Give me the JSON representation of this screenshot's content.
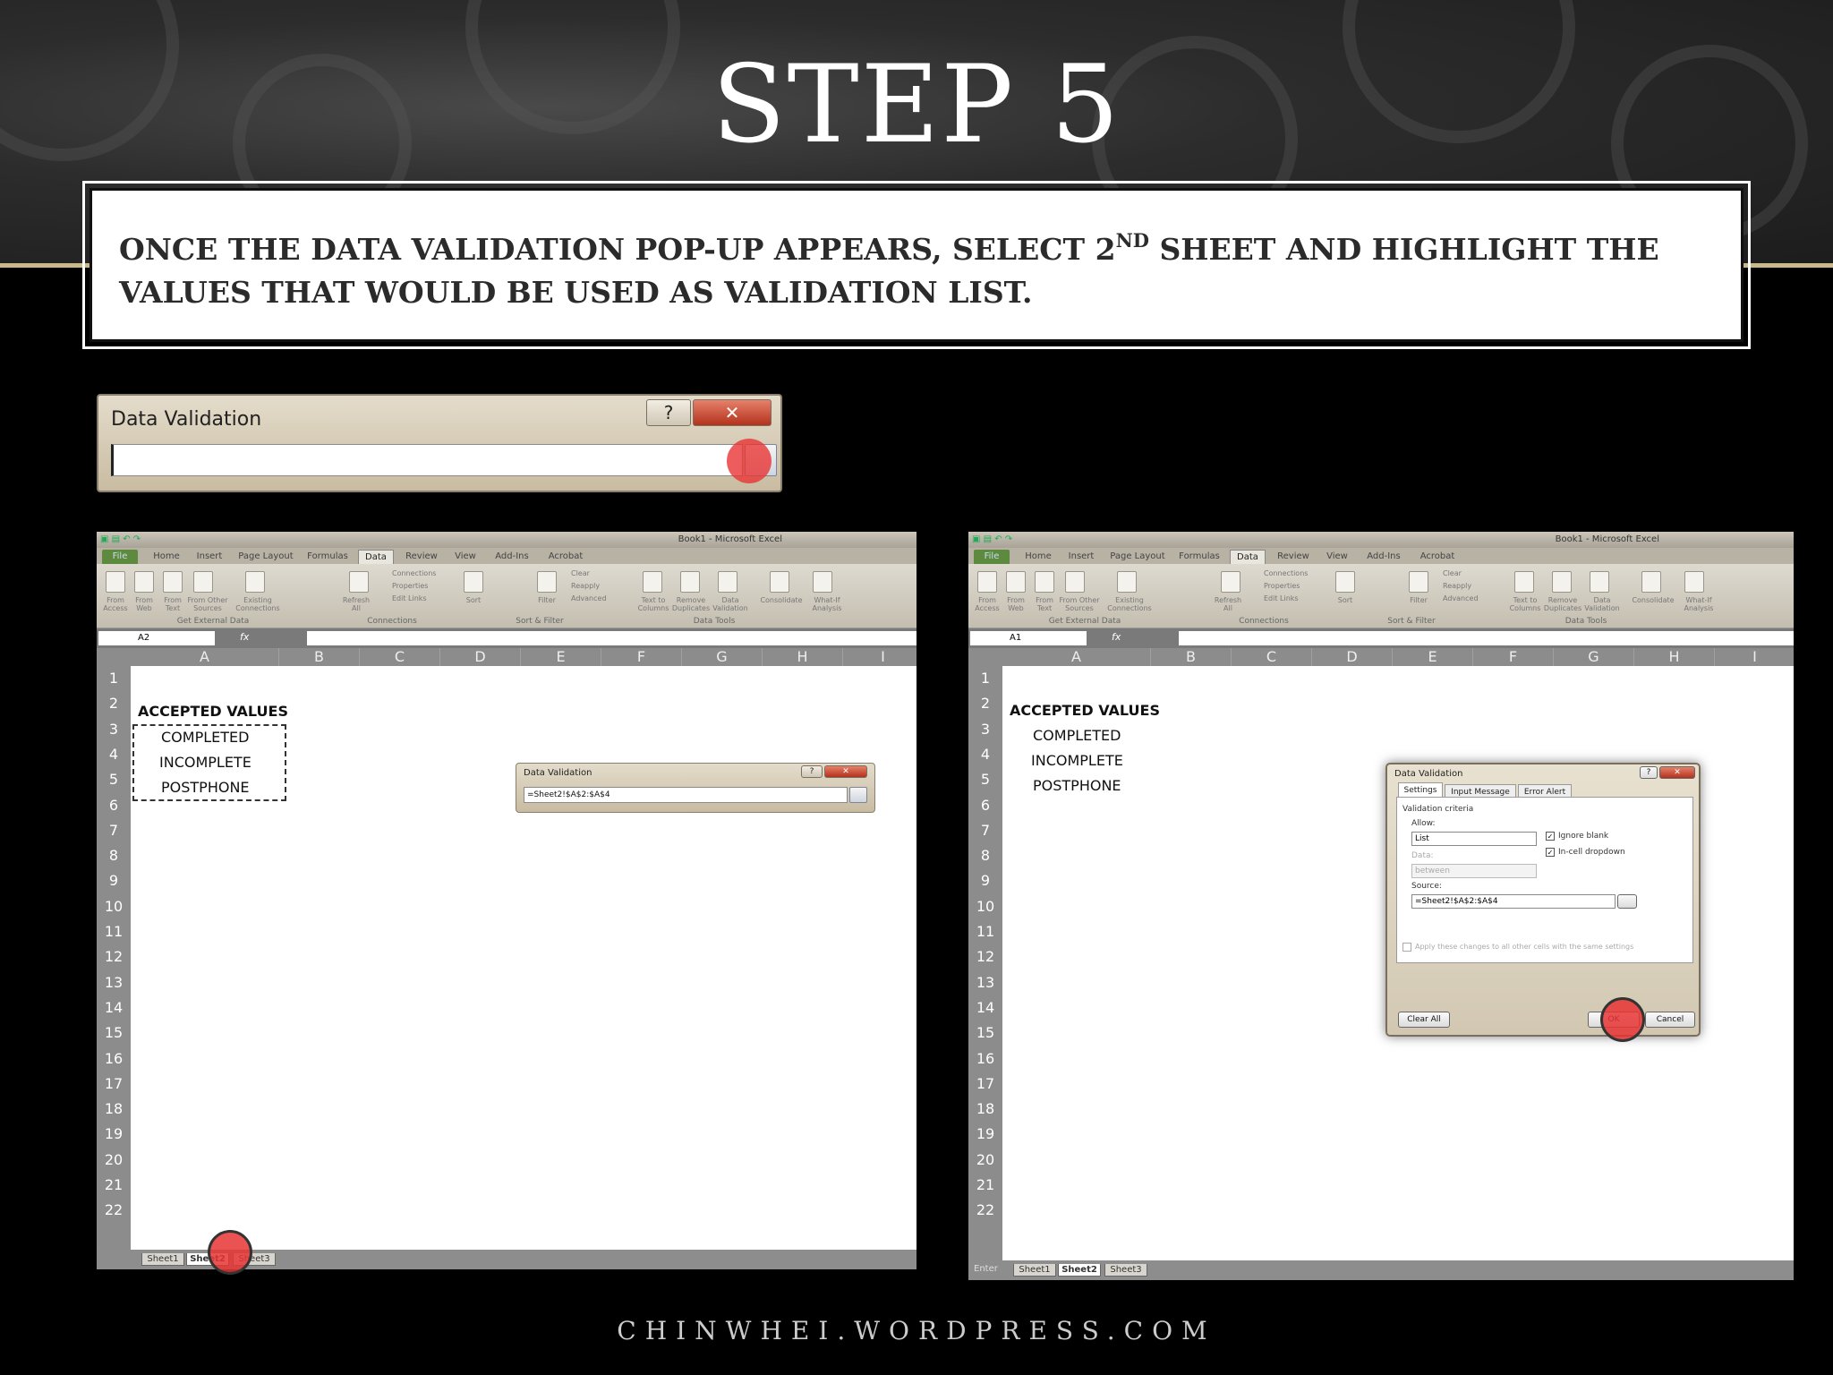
{
  "title": "STEP 5",
  "instruction": {
    "part1": "Once the data validation pop-up appears, select 2",
    "sup": "ND",
    "part2": " sheet and highlight the values that would be used as validation list."
  },
  "footer": "CHINWHEI.WORDPRESS.COM",
  "collapsed_dialog": {
    "title": "Data Validation",
    "help": "?",
    "close": "✕",
    "input_value": ""
  },
  "excel": {
    "window_title": "Book1 - Microsoft Excel",
    "ribbon_tabs": [
      "File",
      "Home",
      "Insert",
      "Page Layout",
      "Formulas",
      "Data",
      "Review",
      "View",
      "Add-Ins",
      "Acrobat"
    ],
    "selected_tab": "Data",
    "ribbon_groups": [
      "Get External Data",
      "Connections",
      "Sort & Filter",
      "Data Tools"
    ],
    "ribbon_items": [
      "From Access",
      "From Web",
      "From Text",
      "From Other Sources",
      "Existing Connections",
      "Refresh All",
      "Sort",
      "Filter",
      "Text to Columns",
      "Remove Duplicates",
      "Data Validation",
      "Consolidate",
      "What-If Analysis"
    ],
    "connections_items": [
      "Connections",
      "Properties",
      "Edit Links"
    ],
    "filter_items": [
      "Clear",
      "Reapply",
      "Advanced"
    ],
    "fx": "fx",
    "columns": [
      "A",
      "B",
      "C",
      "D",
      "E",
      "F",
      "G",
      "H",
      "I"
    ],
    "rows": [
      "1",
      "2",
      "3",
      "4",
      "5",
      "6",
      "7",
      "8",
      "9",
      "10",
      "11",
      "12",
      "13",
      "14",
      "15",
      "16",
      "17",
      "18",
      "19",
      "20",
      "21",
      "22"
    ],
    "cells": {
      "a1": "ACCEPTED VALUES",
      "a2": "COMPLETED",
      "a3": "INCOMPLETE",
      "a4": "POSTPHONE"
    },
    "sheet_tabs": [
      "Sheet1",
      "Sheet2",
      "Sheet3"
    ]
  },
  "left": {
    "name_box": "A2",
    "selected_sheet": "Sheet2",
    "dialog_title": "Data Validation",
    "dialog_input": "=Sheet2!$A$2:$A$4"
  },
  "right": {
    "name_box": "A1",
    "selected_sheet": "Sheet2",
    "status": "Enter",
    "dialog": {
      "title": "Data Validation",
      "tabs": [
        "Settings",
        "Input Message",
        "Error Alert"
      ],
      "criteria_label": "Validation criteria",
      "allow_label": "Allow:",
      "allow_value": "List",
      "data_label": "Data:",
      "data_value": "between",
      "ignore_blank": "Ignore blank",
      "in_cell_dropdown": "In-cell dropdown",
      "source_label": "Source:",
      "source_value": "=Sheet2!$A$2:$A$4",
      "apply_all": "Apply these changes to all other cells with the same settings",
      "clear_all": "Clear All",
      "ok": "OK",
      "cancel": "Cancel"
    }
  },
  "colors": {
    "highlight": "#e83434",
    "gold_line": "#c8b88a"
  }
}
